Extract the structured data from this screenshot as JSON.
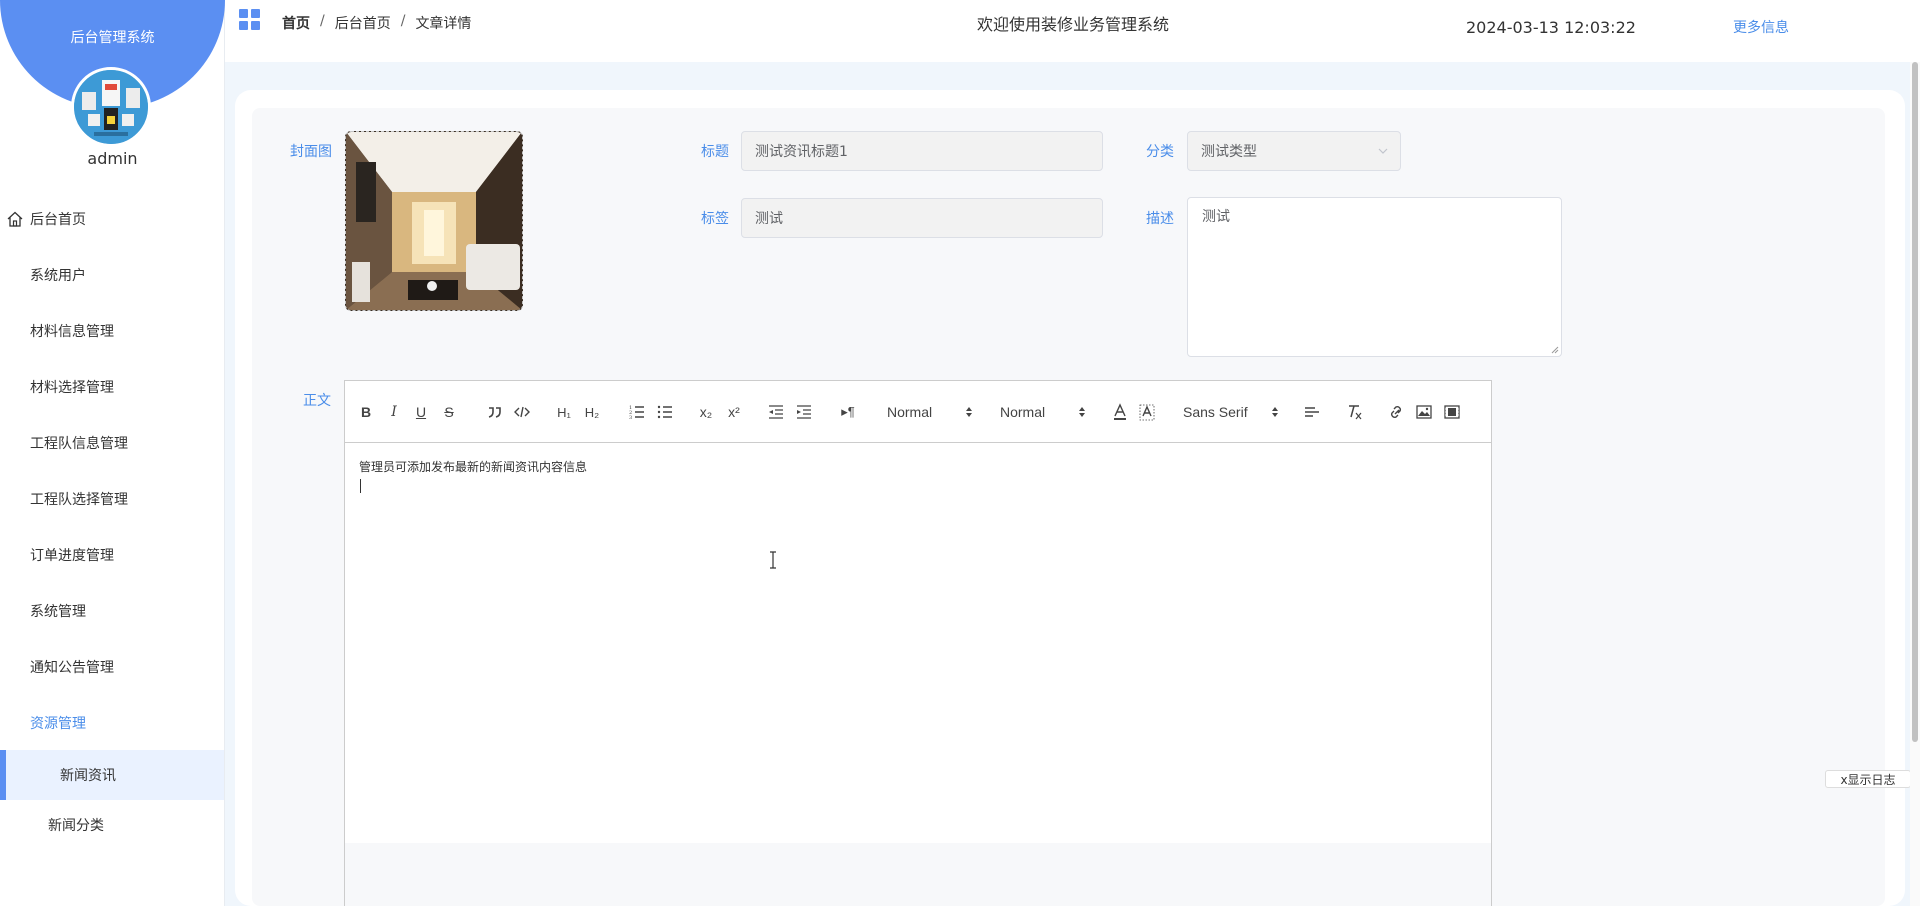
{
  "sidebar": {
    "brand_title": "后台管理系统",
    "username": "admin",
    "items": [
      {
        "label": "后台首页",
        "icon": "home-icon"
      },
      {
        "label": "系统用户"
      },
      {
        "label": "材料信息管理"
      },
      {
        "label": "材料选择管理"
      },
      {
        "label": "工程队信息管理"
      },
      {
        "label": "工程队选择管理"
      },
      {
        "label": "订单进度管理"
      },
      {
        "label": "系统管理"
      },
      {
        "label": "通知公告管理"
      },
      {
        "label": "资源管理",
        "state": "expanded"
      }
    ],
    "subitems": [
      {
        "label": "新闻资讯",
        "state": "active"
      },
      {
        "label": "新闻分类"
      }
    ]
  },
  "topbar": {
    "breadcrumb": [
      "首页",
      "后台首页",
      "文章详情"
    ],
    "breadcrumb_sep": "/",
    "site_title": "欢迎使用装修业务管理系统",
    "datetime": "2024-03-13 12:03:22",
    "more_info": "更多信息"
  },
  "form": {
    "cover_label": "封面图",
    "title_label": "标题",
    "title_value": "测试资讯标题1",
    "category_label": "分类",
    "category_value": "测试类型",
    "tag_label": "标签",
    "tag_value": "测试",
    "desc_label": "描述",
    "desc_value": "测试",
    "body_label": "正文"
  },
  "editor": {
    "toolbar": {
      "header_picker": "Normal",
      "size_picker": "Normal",
      "font_picker": "Sans Serif"
    },
    "content": "管理员可添加发布最新的新闻资讯内容信息"
  },
  "log_toggle": "x显示日志",
  "colors": {
    "accent": "#5b8ff2",
    "link": "#4a8de9",
    "page_bg": "#f0f6fc"
  }
}
